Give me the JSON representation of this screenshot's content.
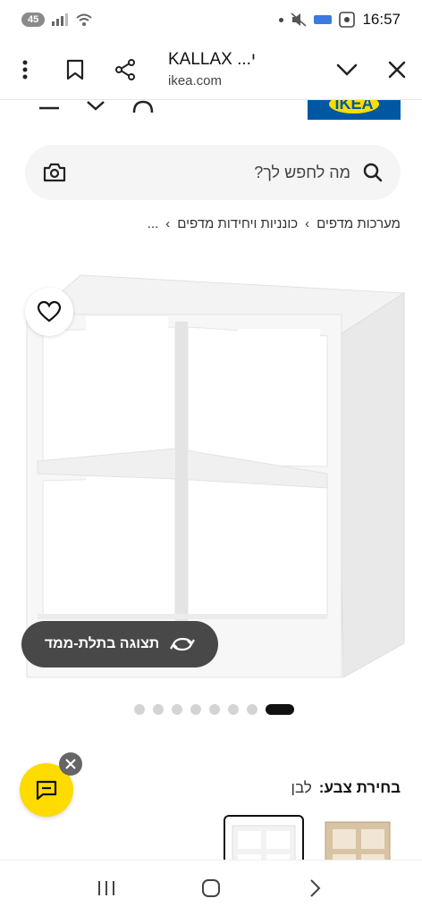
{
  "status_bar": {
    "battery_badge": "45",
    "time": "16:57"
  },
  "browser": {
    "page_title": "KALLAX ...י",
    "host": "ikea.com"
  },
  "header": {
    "logo_text": "IKEA"
  },
  "search": {
    "placeholder": "מה לחפש לך?"
  },
  "breadcrumb": {
    "items": [
      "...",
      "כונניות ויחידות מדפים",
      "מערכות מדפים"
    ],
    "separator": "›"
  },
  "product": {
    "view_3d_label": "תצוגה בתלת-ממד",
    "carousel_total": 8,
    "carousel_active_index": 7
  },
  "color_selection": {
    "label": "בחירת צבע:",
    "value": "לבן"
  },
  "colors": {
    "ikea_blue": "#0058a3",
    "ikea_yellow": "#ffdb00",
    "button_dark": "#484848"
  }
}
